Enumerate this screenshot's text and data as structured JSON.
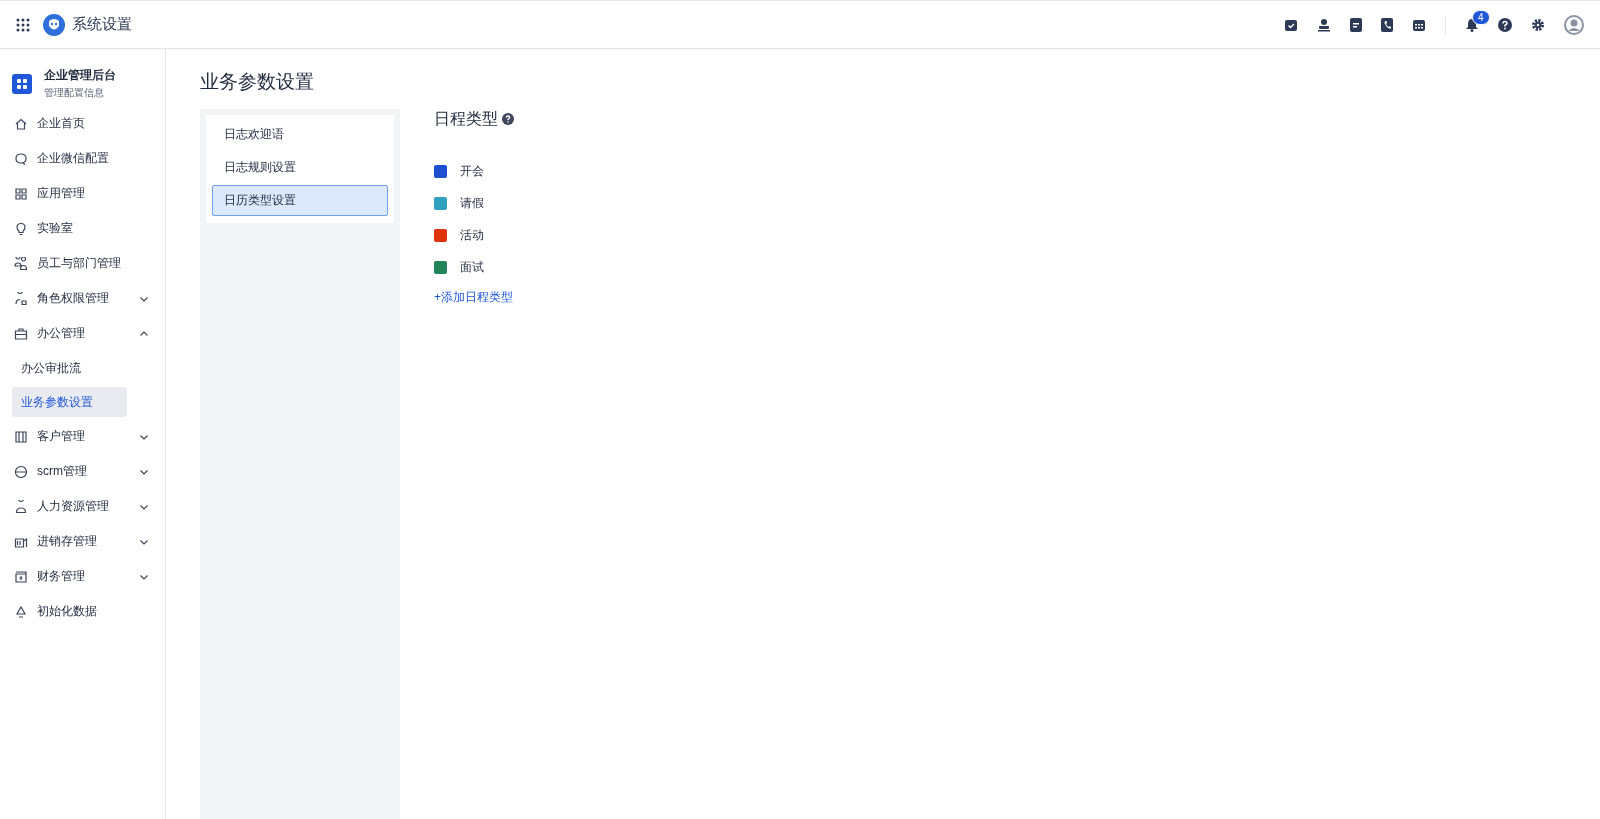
{
  "header": {
    "title": "系统设置",
    "notification_count": "4"
  },
  "sidebar": {
    "title": "企业管理后台",
    "subtitle": "管理配置信息",
    "items": [
      {
        "kind": "link",
        "label": "企业首页"
      },
      {
        "kind": "link",
        "label": "企业微信配置"
      },
      {
        "kind": "link",
        "label": "应用管理"
      },
      {
        "kind": "link",
        "label": "实验室"
      },
      {
        "kind": "link",
        "label": "员工与部门管理"
      },
      {
        "kind": "group",
        "label": "角色权限管理",
        "expanded": false
      },
      {
        "kind": "group",
        "label": "办公管理",
        "expanded": true,
        "children": [
          {
            "label": "办公审批流",
            "selected": false
          },
          {
            "label": "业务参数设置",
            "selected": true
          }
        ]
      },
      {
        "kind": "group",
        "label": "客户管理",
        "expanded": false
      },
      {
        "kind": "group",
        "label": "scrm管理",
        "expanded": false
      },
      {
        "kind": "group",
        "label": "人力资源管理",
        "expanded": false
      },
      {
        "kind": "group",
        "label": "进销存管理",
        "expanded": false
      },
      {
        "kind": "group",
        "label": "财务管理",
        "expanded": false
      },
      {
        "kind": "link",
        "label": "初始化数据"
      }
    ]
  },
  "page_title": "业务参数设置",
  "submenu": [
    {
      "label": "日志欢迎语",
      "selected": false
    },
    {
      "label": "日志规则设置",
      "selected": false
    },
    {
      "label": "日历类型设置",
      "selected": true
    }
  ],
  "section": {
    "title": "日程类型",
    "types": [
      {
        "label": "开会",
        "color": "#1f4fd1"
      },
      {
        "label": "请假",
        "color": "#2fa0bf"
      },
      {
        "label": "活动",
        "color": "#dd330f"
      },
      {
        "label": "面试",
        "color": "#23855a"
      }
    ],
    "add_link": "+添加日程类型"
  }
}
